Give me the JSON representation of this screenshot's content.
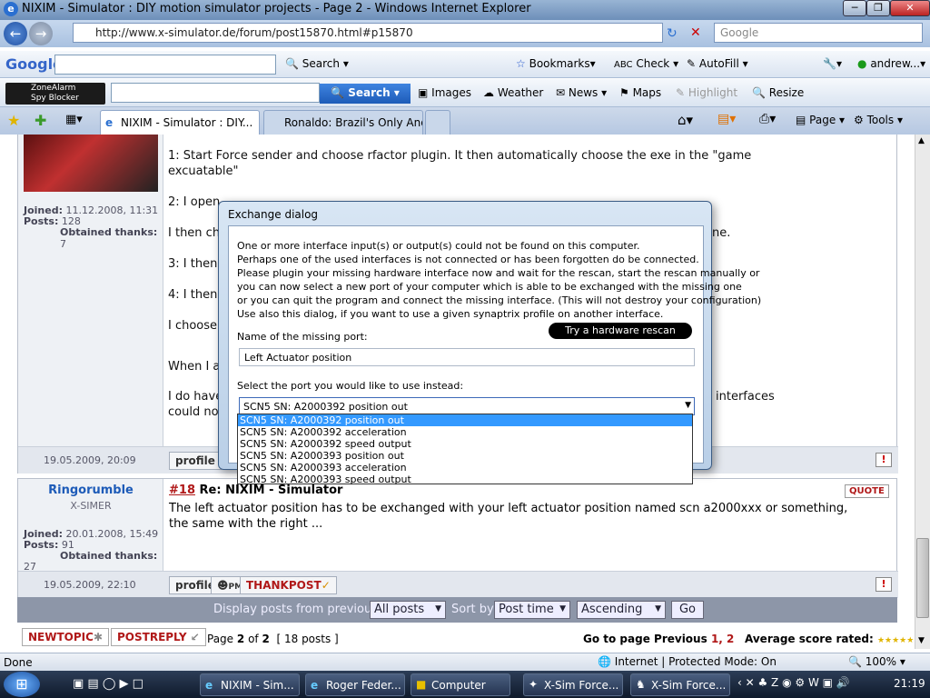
{
  "window": {
    "title": "NIXIM - Simulator : DIY motion simulator projects - Page 2 - Windows Internet Explorer"
  },
  "address_bar": {
    "url": "http://www.x-simulator.de/forum/post15870.html#p15870",
    "search_placeholder": "Google"
  },
  "google_toolbar": {
    "logo": "Google",
    "search": "Search",
    "bookmarks": "Bookmarks",
    "check": "Check",
    "autofill": "AutoFill",
    "user": "andrew..."
  },
  "zonealarm_toolbar": {
    "logo_line1": "ZoneAlarm",
    "logo_line2": "Spy Blocker",
    "search_button": "Search",
    "images": "Images",
    "weather": "Weather",
    "news": "News",
    "maps": "Maps",
    "highlight": "Highlight",
    "resize": "Resize"
  },
  "tabs": [
    {
      "label": "NIXIM - Simulator : DIY..."
    },
    {
      "label": "Ronaldo: Brazil's Only And..."
    }
  ],
  "command_bar": {
    "page": "Page",
    "tools": "Tools"
  },
  "post1": {
    "joined_label": "Joined:",
    "joined": "11.12.2008, 11:31",
    "posts_label": "Posts:",
    "posts": "128",
    "thanks_label": "Obtained thanks:",
    "thanks": "7",
    "lines": [
      "1: Start Force sender and choose rfactor plugin. It then automatically choose the exe in the \"game",
      "excuatable\"",
      "2: I open",
      "I then ch",
      "ne.",
      "3: I then",
      "4: I then",
      "I choose",
      "When I a",
      "I do have",
      "interfaces",
      "could not"
    ],
    "date": "19.05.2009, 20:09",
    "profile": "profile"
  },
  "post2": {
    "author": "Ringorumble",
    "rank": "X-SIMER",
    "joined_label": "Joined:",
    "joined": "20.01.2008, 15:49",
    "posts_label": "Posts:",
    "posts": "91",
    "thanks_label": "Obtained thanks:",
    "thanks": "27",
    "number": "#18",
    "subject": "Re: NIXIM - Simulator",
    "quote": "QUOTE",
    "line1": "The left actuator position has to be exchanged with your left actuator position named scn a2000xxx or something,",
    "line2": "the same with the right ...",
    "date": "19.05.2009, 22:10",
    "profile": "profile",
    "pm": "PM",
    "thankpost": "THANKPOST"
  },
  "display_bar": {
    "label": "Display posts from previous:",
    "all_posts": "All posts",
    "sort_label": "Sort by",
    "post_time": "Post time",
    "order": "Ascending",
    "go": "Go"
  },
  "pagination": {
    "newtopic": "NEWTOPIC",
    "postreply": "POSTREPLY",
    "page_info_prefix": "Page",
    "page_current": "2",
    "page_of": "of",
    "page_total": "2",
    "posts_count": "[ 18 posts ]",
    "goto": "Go to page Previous",
    "pages": "1, 2",
    "avg_score": "Average score rated:"
  },
  "dialog": {
    "title": "Exchange dialog",
    "message": [
      "One or more interface input(s) or output(s) could not be found on this computer.",
      "Perhaps one of the used interfaces is not connected or has been forgotten do be connected.",
      "Please plugin your missing hardware interface now and wait for the rescan, start the rescan manually or",
      "you can now select a new port of your computer which is able to be exchanged with the missing one",
      "or you can quit the program and connect the missing interface. (This will not destroy your configuration)",
      "Use also this dialog, if you want to use a given synaptrix profile on another interface."
    ],
    "missing_port_label": "Name of the missing port:",
    "rescan_button": "Try a hardware rescan",
    "missing_port_value": "Left Actuator position",
    "select_label": "Select the port you would like to use instead:",
    "selected": "SCN5 SN: A2000392 position out",
    "options": [
      "SCN5 SN: A2000392 position out",
      "SCN5 SN: A2000392 acceleration",
      "SCN5 SN: A2000392 speed output",
      "SCN5 SN: A2000393 position out",
      "SCN5 SN: A2000393 acceleration",
      "SCN5 SN: A2000393 speed output"
    ]
  },
  "status_bar": {
    "status": "Done",
    "zone": "Internet | Protected Mode: On",
    "zoom": "100%"
  },
  "taskbar": {
    "tasks": [
      "NIXIM - Sim...",
      "Roger Feder...",
      "Computer",
      "X-Sim Force...",
      "X-Sim Force..."
    ],
    "clock": "21:19"
  }
}
